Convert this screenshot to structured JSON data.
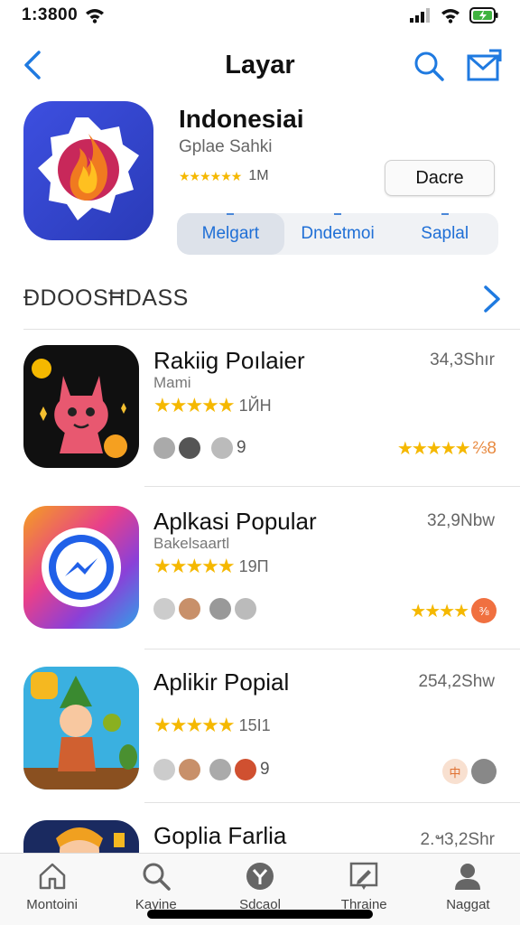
{
  "status": {
    "time": "1:3800",
    "colors": {
      "battery": "#3fb33f"
    }
  },
  "nav": {
    "title": "Layar",
    "back_icon": "chevron-left-icon",
    "search_icon": "search-icon",
    "mail_icon": "mail-icon"
  },
  "app": {
    "name": "Indonesiai",
    "developer": "Gplae Sahki",
    "rating_stars": "★★★★★★",
    "rating_count": "1M",
    "get_label": "Dacre",
    "segments": [
      {
        "label": "Melgart",
        "active": true
      },
      {
        "label": "Dndetmoi",
        "active": false
      },
      {
        "label": "Saplal",
        "active": false
      }
    ]
  },
  "section": {
    "title": "ĐDOOSĦDASS"
  },
  "items": [
    {
      "title": "Rakiig Poılaier",
      "subtitle": "Mami",
      "stars": "★★★★★",
      "count": "1ЙH",
      "size": "34,3Shır",
      "chips_text": "9",
      "right_stars": "★★★★★",
      "right_text": "⅔8"
    },
    {
      "title": "Aplkasi Popular",
      "subtitle": "Bakelsaartl",
      "stars": "★★★★★",
      "count": "19П",
      "size": "32,9Nbw",
      "chips_text": "",
      "right_stars": "★★★★",
      "right_text": "⅜"
    },
    {
      "title": "Aplikir Popial",
      "subtitle": "",
      "stars": "★★★★★",
      "count": "15Ӏ1",
      "size": "254,2Shw",
      "chips_text": "9",
      "right_stars": "",
      "right_text": "中"
    },
    {
      "title": "Goplia Farlia",
      "subtitle": "",
      "stars": "",
      "count": "",
      "size": "2.ฯ3,2Shr",
      "chips_text": "",
      "right_stars": "",
      "right_text": ""
    }
  ],
  "tabs": [
    {
      "label": "Montoini",
      "icon": "home-icon"
    },
    {
      "label": "Kayine",
      "icon": "search-icon"
    },
    {
      "label": "Sdcaol",
      "icon": "explore-icon"
    },
    {
      "label": "Thraine",
      "icon": "edit-icon"
    },
    {
      "label": "Naggat",
      "icon": "profile-icon"
    }
  ]
}
